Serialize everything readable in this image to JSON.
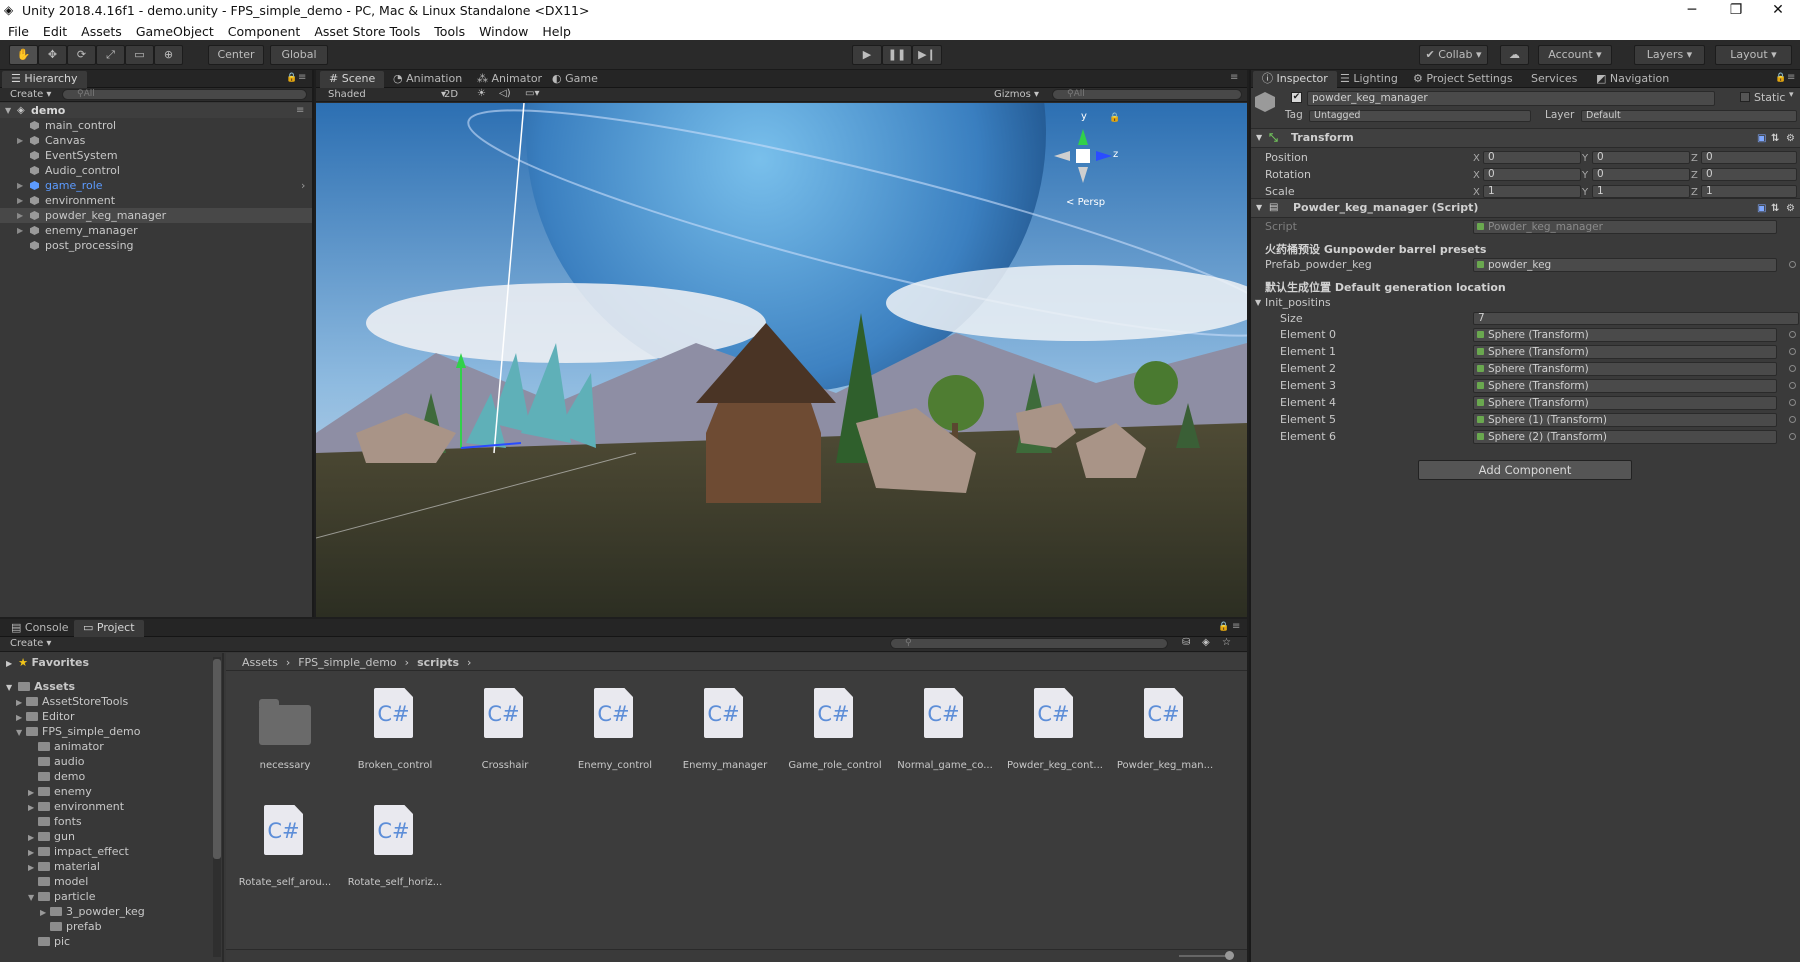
{
  "window": {
    "title": "Unity 2018.4.16f1 - demo.unity - FPS_simple_demo - PC, Mac & Linux Standalone <DX11>"
  },
  "menu": [
    "File",
    "Edit",
    "Assets",
    "GameObject",
    "Component",
    "Asset Store Tools",
    "Tools",
    "Window",
    "Help"
  ],
  "toolbar": {
    "center": "Center",
    "global": "Global",
    "collab": "Collab",
    "account": "Account",
    "layers": "Layers",
    "layout": "Layout"
  },
  "hierarchy": {
    "tab": "Hierarchy",
    "create": "Create",
    "search": "All",
    "scene": "demo",
    "items": [
      {
        "label": "main_control",
        "expandable": false
      },
      {
        "label": "Canvas",
        "expandable": true
      },
      {
        "label": "EventSystem",
        "expandable": false
      },
      {
        "label": "Audio_control",
        "expandable": false
      },
      {
        "label": "game_role",
        "expandable": true,
        "color": "#5c9bff"
      },
      {
        "label": "environment",
        "expandable": true
      },
      {
        "label": "powder_keg_manager",
        "expandable": true,
        "selected": true
      },
      {
        "label": "enemy_manager",
        "expandable": true
      },
      {
        "label": "post_processing",
        "expandable": false
      }
    ]
  },
  "scene": {
    "tabs": [
      "Scene",
      "Animation",
      "Animator",
      "Game"
    ],
    "shading": "Shaded",
    "mode2d": "2D",
    "gizmos": "Gizmos",
    "search": "All",
    "persp": "Persp",
    "axis": {
      "y": "y",
      "z": "z"
    }
  },
  "inspector": {
    "tabs": [
      "Inspector",
      "Lighting",
      "Project Settings",
      "Services",
      "Navigation"
    ],
    "object_name": "powder_keg_manager",
    "static": "Static",
    "tag_label": "Tag",
    "tag": "Untagged",
    "layer_label": "Layer",
    "layer": "Default",
    "transform": {
      "title": "Transform",
      "rows": [
        {
          "label": "Position",
          "x": "0",
          "y": "0",
          "z": "0"
        },
        {
          "label": "Rotation",
          "x": "0",
          "y": "0",
          "z": "0"
        },
        {
          "label": "Scale",
          "x": "1",
          "y": "1",
          "z": "1"
        }
      ]
    },
    "script": {
      "title": "Powder_keg_manager (Script)",
      "script_label": "Script",
      "script_value": "Powder_keg_manager",
      "section1": "火药桶预设 Gunpowder barrel presets",
      "prefab_label": "Prefab_powder_keg",
      "prefab_value": "powder_keg",
      "section2": "默认生成位置 Default generation location",
      "array_label": "Init_positins",
      "size_label": "Size",
      "size_value": "7",
      "elements": [
        {
          "label": "Element 0",
          "value": "Sphere (Transform)"
        },
        {
          "label": "Element 1",
          "value": "Sphere (Transform)"
        },
        {
          "label": "Element 2",
          "value": "Sphere (Transform)"
        },
        {
          "label": "Element 3",
          "value": "Sphere (Transform)"
        },
        {
          "label": "Element 4",
          "value": "Sphere (Transform)"
        },
        {
          "label": "Element 5",
          "value": "Sphere (1) (Transform)"
        },
        {
          "label": "Element 6",
          "value": "Sphere (2) (Transform)"
        }
      ]
    },
    "add_component": "Add Component"
  },
  "bottom": {
    "tabs": [
      "Console",
      "Project"
    ],
    "create": "Create",
    "breadcrumb": [
      "Assets",
      "FPS_simple_demo",
      "scripts"
    ],
    "favorites": "Favorites",
    "assets": "Assets",
    "tree": [
      {
        "label": "AssetStoreTools",
        "depth": 1,
        "arrow": "right"
      },
      {
        "label": "Editor",
        "depth": 1,
        "arrow": "right"
      },
      {
        "label": "FPS_simple_demo",
        "depth": 1,
        "arrow": "down"
      },
      {
        "label": "animator",
        "depth": 2,
        "arrow": ""
      },
      {
        "label": "audio",
        "depth": 2,
        "arrow": ""
      },
      {
        "label": "demo",
        "depth": 2,
        "arrow": ""
      },
      {
        "label": "enemy",
        "depth": 2,
        "arrow": "right"
      },
      {
        "label": "environment",
        "depth": 2,
        "arrow": "right"
      },
      {
        "label": "fonts",
        "depth": 2,
        "arrow": ""
      },
      {
        "label": "gun",
        "depth": 2,
        "arrow": "right"
      },
      {
        "label": "impact_effect",
        "depth": 2,
        "arrow": "right"
      },
      {
        "label": "material",
        "depth": 2,
        "arrow": "right"
      },
      {
        "label": "model",
        "depth": 2,
        "arrow": ""
      },
      {
        "label": "particle",
        "depth": 2,
        "arrow": "down"
      },
      {
        "label": "3_powder_keg",
        "depth": 3,
        "arrow": "right"
      },
      {
        "label": "prefab",
        "depth": 3,
        "arrow": ""
      },
      {
        "label": "pic",
        "depth": 2,
        "arrow": ""
      }
    ],
    "files": [
      {
        "name": "necessary",
        "type": "folder",
        "label": ""
      },
      {
        "name": "Broken_control",
        "type": "script",
        "label": "C#"
      },
      {
        "name": "Crosshair",
        "type": "script",
        "label": "C#"
      },
      {
        "name": "Enemy_control",
        "type": "script",
        "label": "C#"
      },
      {
        "name": "Enemy_manager",
        "type": "script",
        "label": "C#"
      },
      {
        "name": "Game_role_control",
        "type": "script",
        "label": "C#"
      },
      {
        "name": "Normal_game_co...",
        "type": "script",
        "label": "C#"
      },
      {
        "name": "Powder_keg_cont...",
        "type": "script",
        "label": "C#"
      },
      {
        "name": "Powder_keg_man...",
        "type": "script",
        "label": "C#"
      },
      {
        "name": "Rotate_self_arou...",
        "type": "script",
        "label": "C#"
      },
      {
        "name": "Rotate_self_horiz...",
        "type": "script",
        "label": "C#"
      }
    ]
  }
}
